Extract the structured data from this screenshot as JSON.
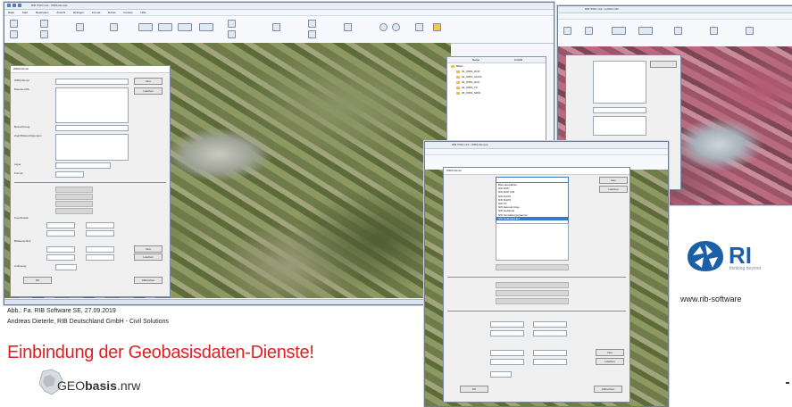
{
  "caption": {
    "line1": "Abb.: Fa. RIB Software SE, 27.09.2019",
    "line2": "Andreas Dieterle, RIB Deutschland GmbH - Civil Solutions"
  },
  "headline": "Einbindung der Geobasisdaten-Dienste!",
  "geobasis_logo": {
    "prefix": "GEO",
    "bold": "basis",
    "suffix": ".nrw"
  },
  "rib_logo": {
    "text": "RI",
    "tagline": "thinking beyond",
    "url": "www.rib-software"
  },
  "win_main": {
    "title": "RIB iTWO civil  - WMS-Dienste",
    "menu": [
      "Datei",
      "Start",
      "Bearbeiten",
      "Ansicht",
      "Einfügen",
      "Format",
      "Extras",
      "Fenster",
      "Hilfe"
    ],
    "dialog_title": "WMS-Dienst",
    "labels": [
      "WMS-Dienst",
      "Dienste-URL",
      "Bezeichnung",
      "Zugriffsberechtigungen",
      "Layer",
      "Format",
      "Koordinaten",
      "Bildausschnitt",
      "Auflösung"
    ],
    "button_new": "Neu",
    "button_delete": "Löschen",
    "button_ok": "OK",
    "button_cancel": "Abbrechen",
    "tree": [
      "Bilder",
      "01_WMS_DOP",
      "02_WMS_ALKIS",
      "03_WMS_DGK",
      "04_WMS_TK",
      "05_WMS_NRW"
    ],
    "tree_header": [
      "Name",
      "Anzahl"
    ]
  },
  "win_right": {
    "title": "RIB iTWO civil - Luftbild CIR"
  },
  "win_front": {
    "title": "RIB iTWO civil  - WMS-Dienste",
    "dialog_title": "WMS-Dienst",
    "dropdown_options": [
      "Bitte auswählen",
      "NW DOP",
      "NW DOP CIR",
      "NW ALKIS",
      "NW DGK5",
      "NW TK",
      "NW Hausumringe",
      "NW Gebäude",
      "NW Verwaltungsgrenzen",
      "NW Geländerelief"
    ],
    "button_new": "Neu",
    "button_delete": "Löschen",
    "button_ok": "OK",
    "button_cancel": "Abbrechen"
  },
  "colors": {
    "headline_red": "#e02020",
    "rib_blue": "#1a5fa8",
    "ribbon": "#f7f9fc"
  }
}
